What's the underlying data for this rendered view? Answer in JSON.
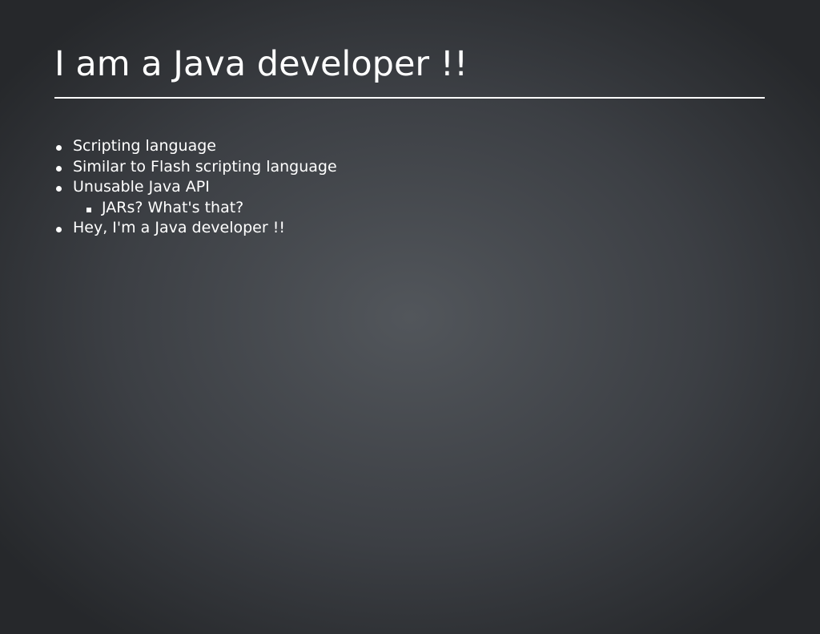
{
  "slide": {
    "title": "I am a Java developer !!",
    "bullets": [
      {
        "text": "Scripting language",
        "level": 1
      },
      {
        "text": "Similar to Flash scripting language",
        "level": 1
      },
      {
        "text": "Unusable Java API",
        "level": 1
      },
      {
        "text": "JARs? What's that?",
        "level": 2
      },
      {
        "text": "Hey, I'm a Java developer !!",
        "level": 1
      }
    ]
  },
  "colors": {
    "background_center": "#52565b",
    "background_edge": "#26282b",
    "text": "#ffffff"
  }
}
